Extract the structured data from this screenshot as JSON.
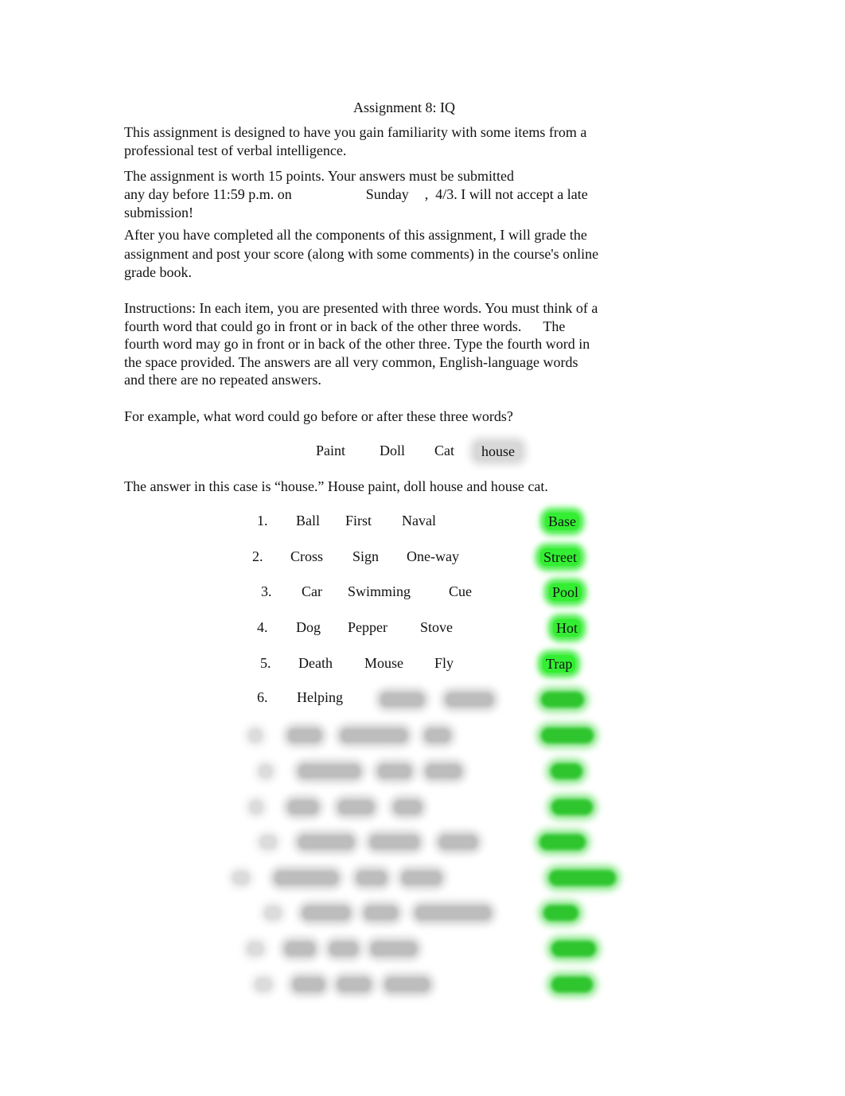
{
  "document": {
    "title": "Assignment 8: IQ",
    "intro": "This assignment is designed to have you gain familiarity with some items from a professional test of verbal intelligence.",
    "worth": {
      "line1": "The assignment is worth 15 points. Your answers must be submitted",
      "line2_before": "any day before 11:59 p.m. on",
      "day": "Sunday",
      "line2_after": ",  4/3. I will not accept a late",
      "line3": "submission!"
    },
    "grading": "After you have completed all the components of this assignment, I will grade the assignment and post your score (along with some comments) in the course's online grade book.",
    "instructions_part1": "Instructions: In each item, you are presented with three words. You must think of a fourth word that could go in front or in back of the other three words.",
    "instructions_part2": "The fourth word may go in front or in back of the other three. Type the fourth word in the space provided. The answers are all very common, English-language words and there are no repeated answers.",
    "example_prompt": "For example, what word could go before or after these three words?",
    "example": {
      "words": [
        "Paint",
        "Doll",
        "Cat"
      ],
      "answer": "house"
    },
    "example_explanation": "The answer in this case is “house.” House paint, doll house and house cat."
  },
  "items": [
    {
      "number": "1.",
      "words": [
        "Ball",
        "First",
        "Naval"
      ],
      "answer": "Base"
    },
    {
      "number": "2.",
      "words": [
        "Cross",
        "Sign",
        "One-way"
      ],
      "answer": "Street"
    },
    {
      "number": "3.",
      "words": [
        "Car",
        "Swimming",
        "Cue"
      ],
      "answer": "Pool"
    },
    {
      "number": "4.",
      "words": [
        "Dog",
        "Pepper",
        "Stove"
      ],
      "answer": "Hot"
    },
    {
      "number": "5.",
      "words": [
        "Death",
        "Mouse",
        "Fly"
      ],
      "answer": "Trap"
    },
    {
      "number": "6.",
      "words": [
        "Helping",
        "[blurred]",
        "[blurred]"
      ],
      "answer": "[blurred]"
    }
  ],
  "redacted_items_count": 8,
  "colors": {
    "answer_highlight": "#33ee33",
    "example_highlight": "#d8d8d8",
    "redacted_answer": "#2ec52e",
    "text": "#111111"
  }
}
